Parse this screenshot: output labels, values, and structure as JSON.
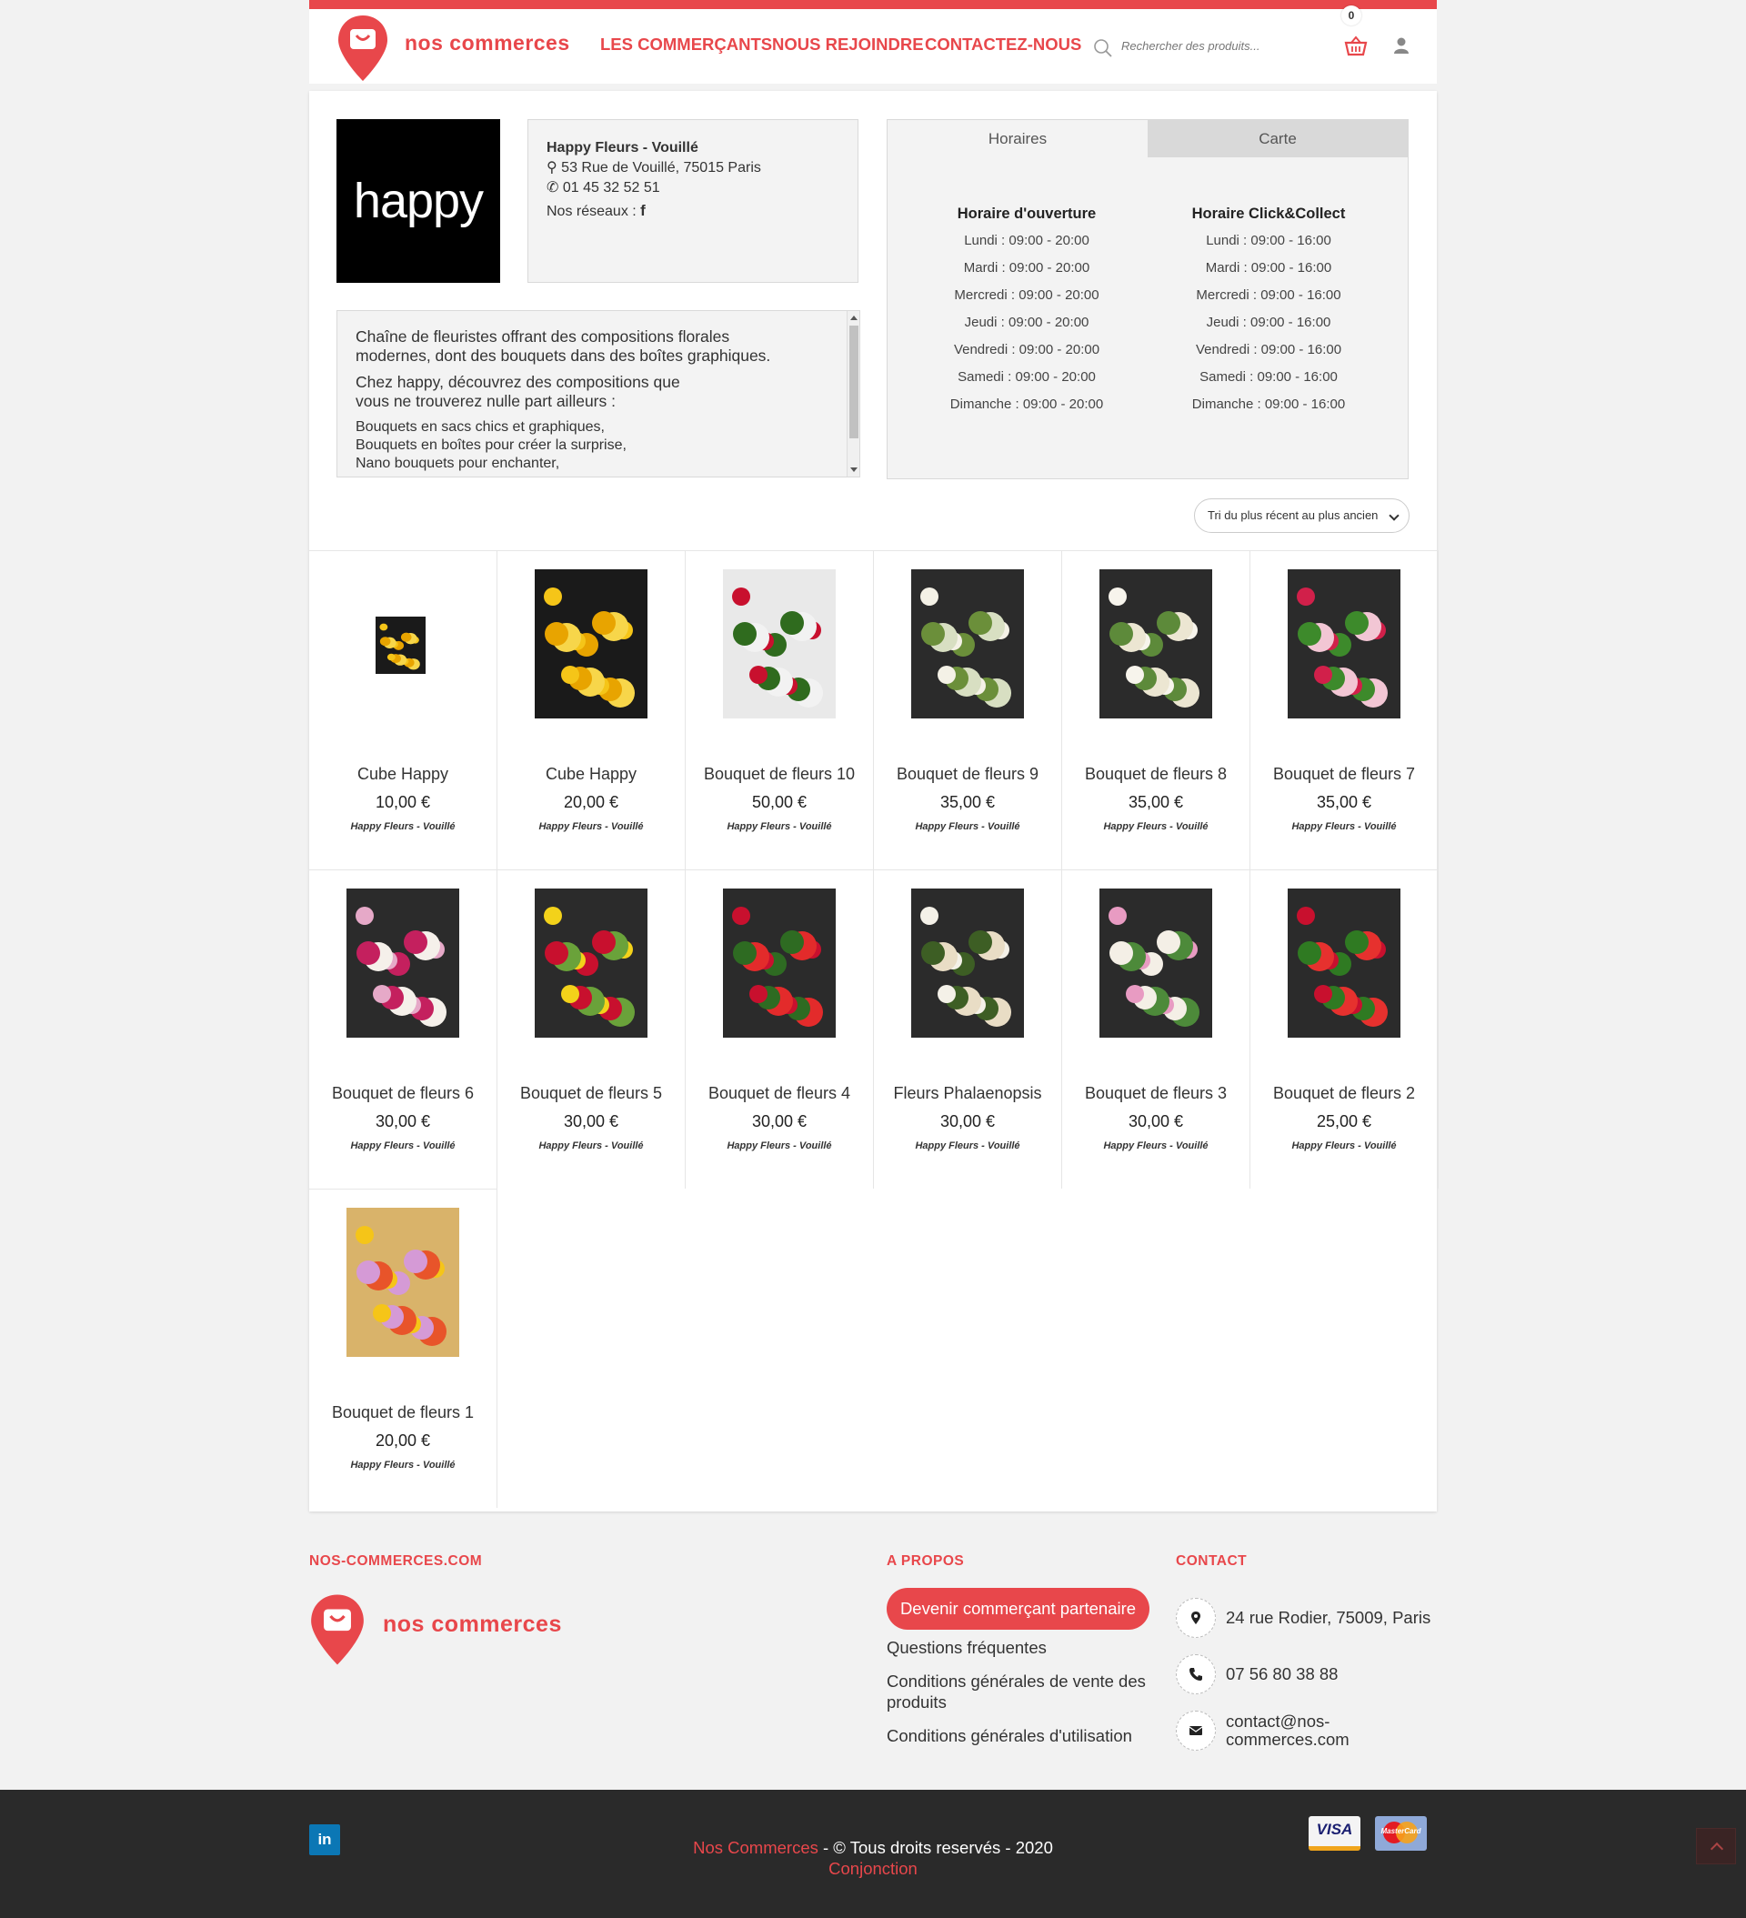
{
  "header": {
    "logo_text": "nos commerces",
    "nav": [
      "LES COMMERÇANTS",
      "NOUS REJOINDRE",
      "CONTACTEZ-NOUS"
    ],
    "search_placeholder": "Rechercher des produits...",
    "cart_count": "0",
    "accent_color": "#e8474b"
  },
  "shop": {
    "logo_text": "happy",
    "name": "Happy Fleurs - Vouillé",
    "address": "53 Rue de Vouillé, 75015 Paris",
    "phone": "01 45 32 52 51",
    "social_label": "Nos réseaux :",
    "description": [
      "Chaîne de fleuristes offrant des compositions florales modernes, dont des bouquets dans des boîtes graphiques.",
      "Chez happy, découvrez des compositions que vous ne trouverez nulle part ailleurs :"
    ],
    "description_list": [
      "Bouquets en sacs chics et graphiques,",
      "Bouquets en boîtes pour créer la surprise,",
      "Nano bouquets pour enchanter,"
    ]
  },
  "hours": {
    "tabs": [
      "Horaires",
      "Carte"
    ],
    "opening_title": "Horaire d'ouverture",
    "opening": [
      "Lundi : 09:00 - 20:00",
      "Mardi : 09:00 - 20:00",
      "Mercredi : 09:00 - 20:00",
      "Jeudi : 09:00 - 20:00",
      "Vendredi : 09:00 - 20:00",
      "Samedi : 09:00 - 20:00",
      "Dimanche : 09:00 - 20:00"
    ],
    "click_title": "Horaire Click&Collect",
    "click": [
      "Lundi : 09:00 - 16:00",
      "Mardi : 09:00 - 16:00",
      "Mercredi : 09:00 - 16:00",
      "Jeudi : 09:00 - 16:00",
      "Vendredi : 09:00 - 16:00",
      "Samedi : 09:00 - 16:00",
      "Dimanche : 09:00 - 16:00"
    ]
  },
  "sort": {
    "selected": "Tri du plus récent au plus ancien"
  },
  "products": [
    {
      "name": "Cube Happy",
      "price": "10,00 €",
      "shop": "Happy Fleurs - Vouillé"
    },
    {
      "name": "Cube Happy",
      "price": "20,00 €",
      "shop": "Happy Fleurs - Vouillé"
    },
    {
      "name": "Bouquet de fleurs 10",
      "price": "50,00 €",
      "shop": "Happy Fleurs - Vouillé"
    },
    {
      "name": "Bouquet de fleurs 9",
      "price": "35,00 €",
      "shop": "Happy Fleurs - Vouillé"
    },
    {
      "name": "Bouquet de fleurs 8",
      "price": "35,00 €",
      "shop": "Happy Fleurs - Vouillé"
    },
    {
      "name": "Bouquet de fleurs 7",
      "price": "35,00 €",
      "shop": "Happy Fleurs - Vouillé"
    },
    {
      "name": "Bouquet de fleurs 6",
      "price": "30,00 €",
      "shop": "Happy Fleurs - Vouillé"
    },
    {
      "name": "Bouquet de fleurs 5",
      "price": "30,00 €",
      "shop": "Happy Fleurs - Vouillé"
    },
    {
      "name": "Bouquet de fleurs 4",
      "price": "30,00 €",
      "shop": "Happy Fleurs - Vouillé"
    },
    {
      "name": "Fleurs Phalaenopsis",
      "price": "30,00 €",
      "shop": "Happy Fleurs - Vouillé"
    },
    {
      "name": "Bouquet de fleurs 3",
      "price": "30,00 €",
      "shop": "Happy Fleurs - Vouillé"
    },
    {
      "name": "Bouquet de fleurs 2",
      "price": "25,00 €",
      "shop": "Happy Fleurs - Vouillé"
    },
    {
      "name": "Bouquet de fleurs 1",
      "price": "20,00 €",
      "shop": "Happy Fleurs - Vouillé"
    }
  ],
  "footer": {
    "col1_title": "NOS-COMMERCES.COM",
    "logo_text": "nos commerces",
    "col2_title": "A PROPOS",
    "partner_button": "Devenir commerçant partenaire",
    "links": [
      "Questions fréquentes",
      "Conditions générales de vente des produits",
      "Conditions générales d'utilisation"
    ],
    "col3_title": "CONTACT",
    "address": "24 rue Rodier, 75009, Paris",
    "phone": "07 56 80 38 88",
    "email": "contact@nos-commerces.com",
    "linkedin": "in",
    "copyright_brand": "Nos Commerces",
    "copyright_rest": " - © Tous droits reservés - 2020",
    "credit": "Conjonction",
    "visa": "VISA",
    "mastercard": "MasterCard"
  }
}
